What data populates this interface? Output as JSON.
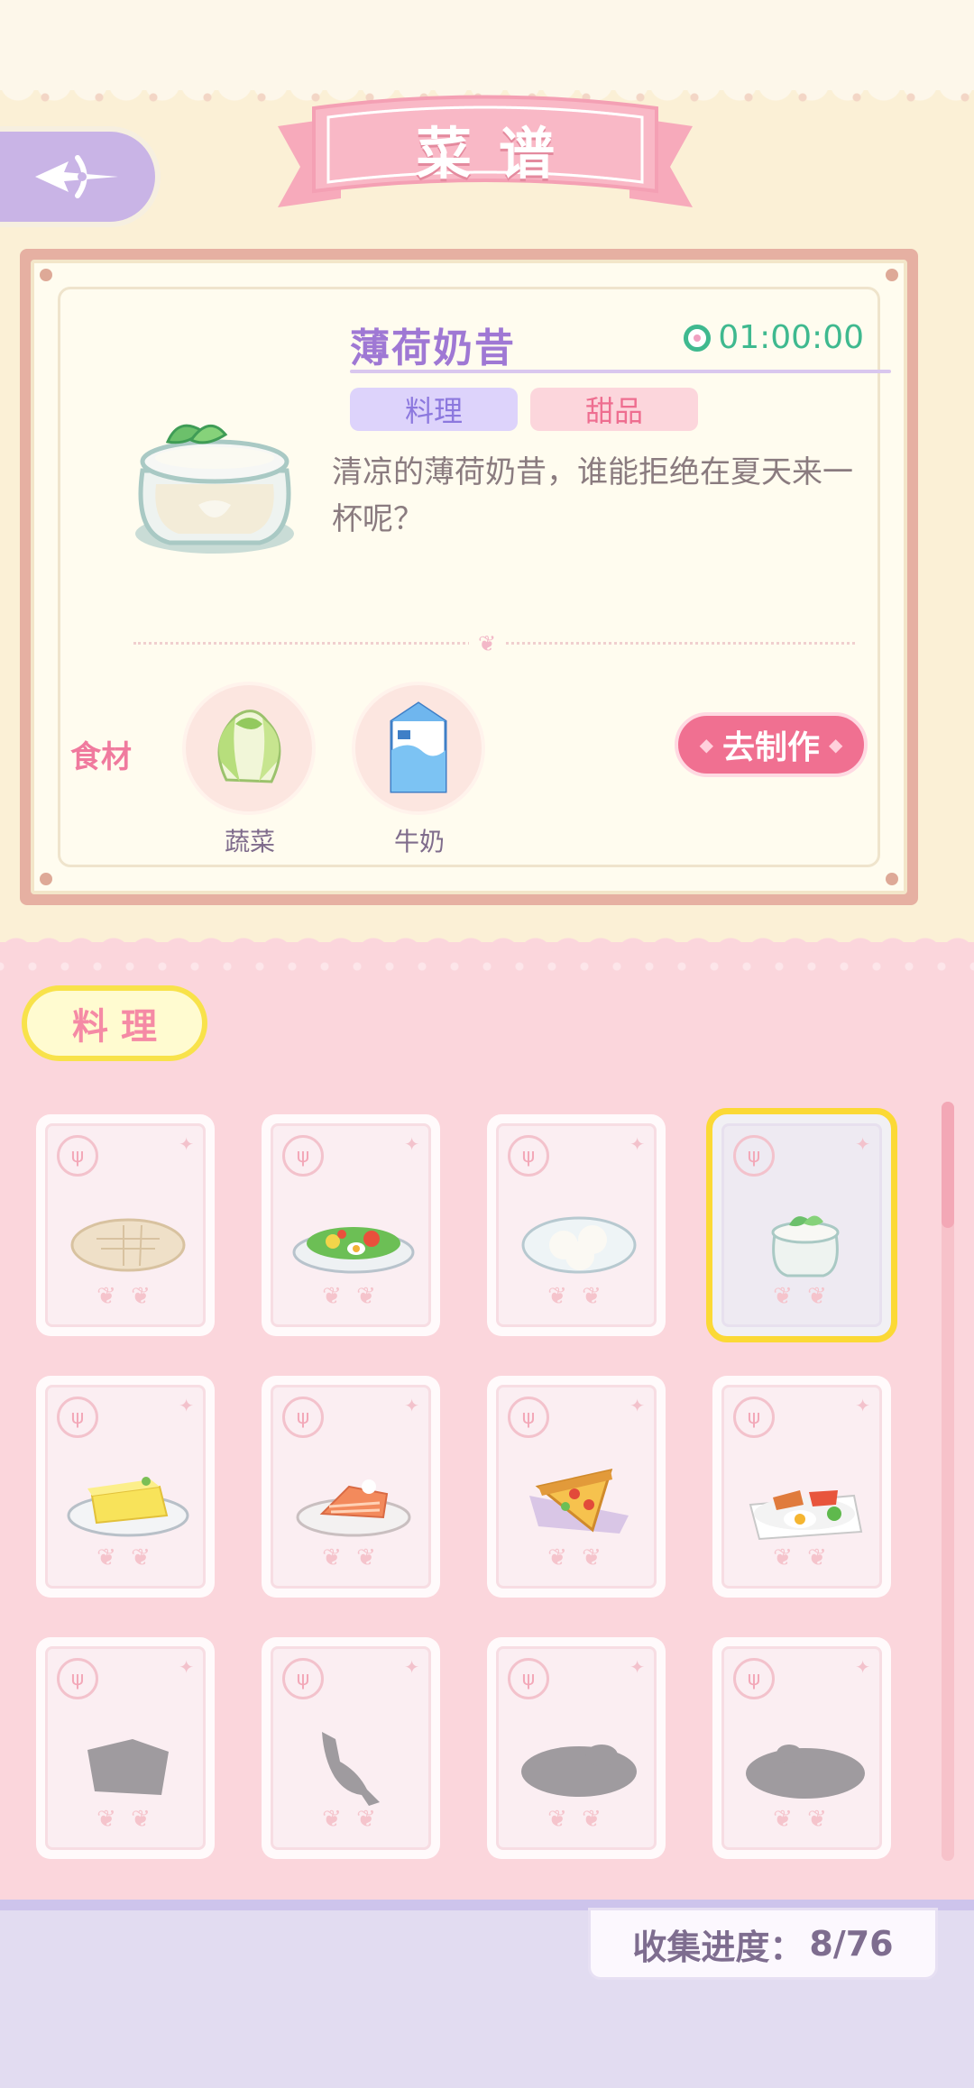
{
  "header": {
    "title": "菜谱"
  },
  "detail": {
    "dish_name": "薄荷奶昔",
    "timer": "01:00:00",
    "tags": [
      "料理",
      "甜品"
    ],
    "description": "清凉的薄荷奶昔，谁能拒绝在夏天来一杯呢？",
    "ingredients_label": "食材",
    "ingredients": [
      {
        "name": "蔬菜",
        "icon": "cabbage-icon"
      },
      {
        "name": "牛奶",
        "icon": "milk-carton-icon"
      }
    ],
    "make_button": "去制作"
  },
  "category_tab": "料理",
  "recipes": [
    {
      "food": "flatbread",
      "unlocked": true
    },
    {
      "food": "salad",
      "unlocked": true
    },
    {
      "food": "rice-balls",
      "unlocked": true
    },
    {
      "food": "mint-milkshake",
      "unlocked": true,
      "selected": true
    },
    {
      "food": "cheese-cake",
      "unlocked": true
    },
    {
      "food": "salmon-cake",
      "unlocked": true
    },
    {
      "food": "pizza-slice",
      "unlocked": true
    },
    {
      "food": "breakfast-plate",
      "unlocked": true
    },
    {
      "food": "locked-pie",
      "unlocked": false
    },
    {
      "food": "locked-fish",
      "unlocked": false
    },
    {
      "food": "locked-dish",
      "unlocked": false
    },
    {
      "food": "locked-plate",
      "unlocked": false
    }
  ],
  "progress": {
    "label": "收集进度：",
    "value": "8/76"
  },
  "colors": {
    "accent_pink": "#f07091",
    "lavender": "#9f78d4",
    "selected_border": "#fbd935",
    "timer_green": "#3fb98f"
  }
}
